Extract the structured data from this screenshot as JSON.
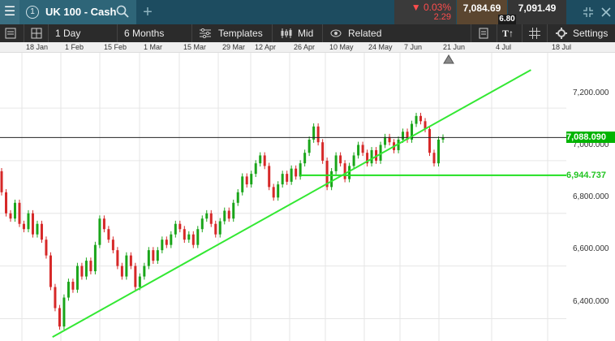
{
  "topbar": {
    "menu_icon": "hamburger-icon",
    "tab": {
      "number": "1",
      "instrument": "UK 100 - Cash",
      "search_icon": "search-icon"
    },
    "add_tab_icon": "plus-icon",
    "change": {
      "percent": "0.03%",
      "points": "2.29",
      "direction_icon": "triangle-down-icon",
      "color": "#ff4d4d"
    },
    "sell_price": "7,084.69",
    "spread": "6.80",
    "buy_price": "7,091.49"
  },
  "toolbar": {
    "interval": "1 Day",
    "range": "6 Months",
    "templates_label": "Templates",
    "price_type_label": "Mid",
    "related_label": "Related",
    "settings_label": "Settings",
    "icons": [
      "list-icon",
      "layout-icon",
      "templates-icon",
      "candlestick-icon",
      "related-icon",
      "document-icon",
      "text-icon",
      "grid-icon",
      "gear-icon"
    ]
  },
  "date_axis": [
    "18 Jan",
    "1 Feb",
    "15 Feb",
    "1 Mar",
    "15 Mar",
    "29 Mar",
    "12 Apr",
    "26 Apr",
    "10 May",
    "24 May",
    "7 Jun",
    "21 Jun",
    "4 Jul",
    "18 Jul"
  ],
  "price_axis": [
    "7,200.000",
    "7,000.000",
    "6,800.000",
    "6,600.000",
    "6,400.000"
  ],
  "current_price": {
    "label": "7,088.090",
    "value": 7088.09,
    "color": "#00b400"
  },
  "horizontal_line": {
    "label": "6,944.737",
    "value": 6944.737,
    "color": "#22e022"
  },
  "chart_data": {
    "type": "candlestick",
    "ylim": [
      6315,
      7410
    ],
    "trendline": {
      "from": {
        "date": "2021-01-29",
        "price": 6330
      },
      "to": {
        "date": "2021-07-20",
        "price": 7345
      }
    },
    "candles": [
      {
        "o": 6960,
        "c": 6880
      },
      {
        "o": 6880,
        "c": 6800
      },
      {
        "o": 6800,
        "c": 6780
      },
      {
        "o": 6780,
        "c": 6840
      },
      {
        "o": 6840,
        "c": 6760
      },
      {
        "o": 6760,
        "c": 6740
      },
      {
        "o": 6740,
        "c": 6800
      },
      {
        "o": 6800,
        "c": 6720
      },
      {
        "o": 6720,
        "c": 6760
      },
      {
        "o": 6760,
        "c": 6700
      },
      {
        "o": 6700,
        "c": 6640
      },
      {
        "o": 6640,
        "c": 6520
      },
      {
        "o": 6520,
        "c": 6440
      },
      {
        "o": 6440,
        "c": 6370
      },
      {
        "o": 6370,
        "c": 6480
      },
      {
        "o": 6480,
        "c": 6540
      },
      {
        "o": 6540,
        "c": 6510
      },
      {
        "o": 6510,
        "c": 6600
      },
      {
        "o": 6600,
        "c": 6560
      },
      {
        "o": 6560,
        "c": 6620
      },
      {
        "o": 6620,
        "c": 6580
      },
      {
        "o": 6580,
        "c": 6680
      },
      {
        "o": 6680,
        "c": 6780
      },
      {
        "o": 6780,
        "c": 6740
      },
      {
        "o": 6740,
        "c": 6700
      },
      {
        "o": 6700,
        "c": 6660
      },
      {
        "o": 6660,
        "c": 6600
      },
      {
        "o": 6600,
        "c": 6560
      },
      {
        "o": 6560,
        "c": 6640
      },
      {
        "o": 6640,
        "c": 6600
      },
      {
        "o": 6600,
        "c": 6520
      },
      {
        "o": 6520,
        "c": 6560
      },
      {
        "o": 6560,
        "c": 6600
      },
      {
        "o": 6600,
        "c": 6660
      },
      {
        "o": 6660,
        "c": 6620
      },
      {
        "o": 6620,
        "c": 6660
      },
      {
        "o": 6660,
        "c": 6700
      },
      {
        "o": 6700,
        "c": 6680
      },
      {
        "o": 6680,
        "c": 6720
      },
      {
        "o": 6720,
        "c": 6760
      },
      {
        "o": 6760,
        "c": 6740
      },
      {
        "o": 6740,
        "c": 6700
      },
      {
        "o": 6700,
        "c": 6720
      },
      {
        "o": 6720,
        "c": 6680
      },
      {
        "o": 6680,
        "c": 6740
      },
      {
        "o": 6740,
        "c": 6780
      },
      {
        "o": 6780,
        "c": 6800
      },
      {
        "o": 6800,
        "c": 6760
      },
      {
        "o": 6760,
        "c": 6720
      },
      {
        "o": 6720,
        "c": 6770
      },
      {
        "o": 6770,
        "c": 6810
      },
      {
        "o": 6810,
        "c": 6780
      },
      {
        "o": 6780,
        "c": 6840
      },
      {
        "o": 6840,
        "c": 6880
      },
      {
        "o": 6880,
        "c": 6940
      },
      {
        "o": 6940,
        "c": 6910
      },
      {
        "o": 6910,
        "c": 6950
      },
      {
        "o": 6950,
        "c": 6990
      },
      {
        "o": 6990,
        "c": 7020
      },
      {
        "o": 7020,
        "c": 6980
      },
      {
        "o": 6980,
        "c": 6900
      },
      {
        "o": 6900,
        "c": 6860
      },
      {
        "o": 6860,
        "c": 6910
      },
      {
        "o": 6910,
        "c": 6950
      },
      {
        "o": 6950,
        "c": 6920
      },
      {
        "o": 6920,
        "c": 6970
      },
      {
        "o": 6970,
        "c": 6940
      },
      {
        "o": 6940,
        "c": 6990
      },
      {
        "o": 6990,
        "c": 7030
      },
      {
        "o": 7030,
        "c": 7080
      },
      {
        "o": 7080,
        "c": 7130
      },
      {
        "o": 7130,
        "c": 7070
      },
      {
        "o": 7070,
        "c": 7000
      },
      {
        "o": 7000,
        "c": 6900
      },
      {
        "o": 6900,
        "c": 6960
      },
      {
        "o": 6960,
        "c": 7020
      },
      {
        "o": 7020,
        "c": 6990
      },
      {
        "o": 6990,
        "c": 6930
      },
      {
        "o": 6930,
        "c": 6980
      },
      {
        "o": 6980,
        "c": 7020
      },
      {
        "o": 7020,
        "c": 7060
      },
      {
        "o": 7060,
        "c": 7030
      },
      {
        "o": 7030,
        "c": 6990
      },
      {
        "o": 6990,
        "c": 7040
      },
      {
        "o": 7040,
        "c": 7000
      },
      {
        "o": 7000,
        "c": 7060
      },
      {
        "o": 7060,
        "c": 7090
      },
      {
        "o": 7090,
        "c": 7070
      },
      {
        "o": 7070,
        "c": 7040
      },
      {
        "o": 7040,
        "c": 7080
      },
      {
        "o": 7080,
        "c": 7110
      },
      {
        "o": 7110,
        "c": 7080
      },
      {
        "o": 7080,
        "c": 7140
      },
      {
        "o": 7140,
        "c": 7170
      },
      {
        "o": 7170,
        "c": 7150
      },
      {
        "o": 7150,
        "c": 7120
      },
      {
        "o": 7120,
        "c": 7030
      },
      {
        "o": 7030,
        "c": 6990
      },
      {
        "o": 6990,
        "c": 7080
      },
      {
        "o": 7080,
        "c": 7088
      }
    ]
  }
}
